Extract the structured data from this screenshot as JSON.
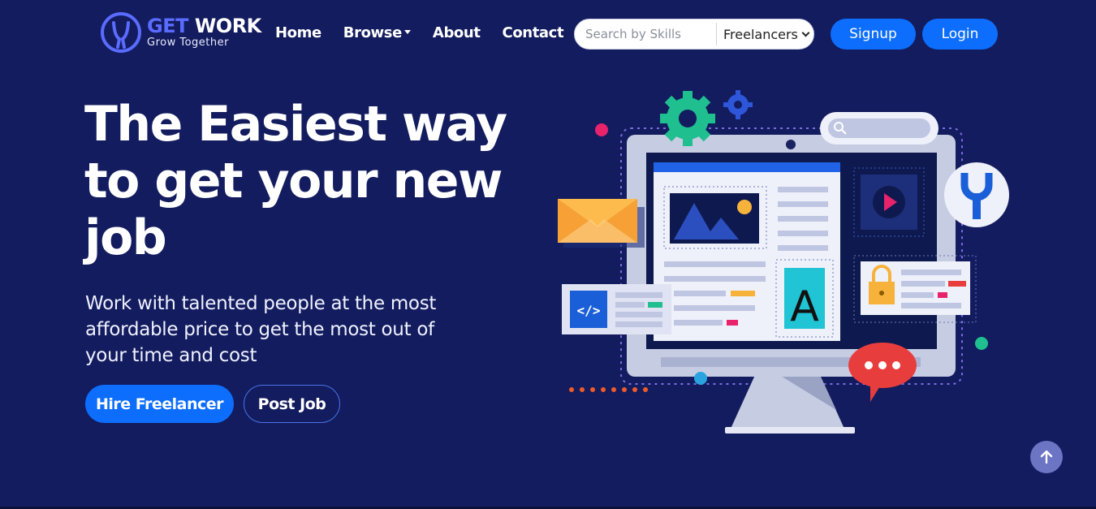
{
  "brand": {
    "name_part1": "GET",
    "name_part2": "WORK",
    "tagline": "Grow Together",
    "logo_icon": "logo-icon"
  },
  "nav": {
    "links": [
      {
        "label": "Home"
      },
      {
        "label": "Browse",
        "has_dropdown": true
      },
      {
        "label": "About"
      },
      {
        "label": "Contact"
      }
    ],
    "search": {
      "placeholder": "Search by Skills",
      "value": ""
    },
    "search_type": {
      "selected": "Freelancers"
    },
    "signup_label": "Signup",
    "login_label": "Login"
  },
  "hero": {
    "title": "The Easiest way to get your new job",
    "subtitle": "Work with talented people at the most affordable price to get the most out of your time and cost",
    "primary_cta": "Hire Freelancer",
    "secondary_cta": "Post Job",
    "illustration_code_label": "</>",
    "illustration_letter": "A"
  },
  "colors": {
    "background": "#131c5e",
    "primary": "#0d6efd",
    "logo_accent": "#5a6bff",
    "scroll_button": "#6c74c4"
  },
  "icons": {
    "scroll_top": "arrow-up-icon",
    "dropdown": "caret-down-icon"
  }
}
